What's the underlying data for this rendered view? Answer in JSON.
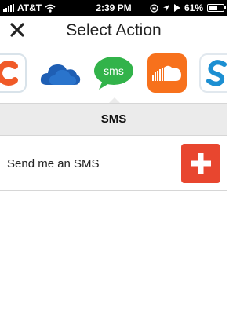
{
  "status_bar": {
    "carrier": "AT&T",
    "time": "2:39 PM",
    "battery_percent": "61%",
    "battery_level": 0.61
  },
  "nav": {
    "title": "Select Action",
    "close_icon": "close-icon"
  },
  "channels": [
    {
      "name": "c-app-icon",
      "color": "#f05a28"
    },
    {
      "name": "cloud-drive-icon",
      "color": "#1f5fb4"
    },
    {
      "name": "sms-icon",
      "label": "sms",
      "color": "#32b34a",
      "selected": true
    },
    {
      "name": "soundcloud-icon",
      "color": "#f7711c"
    },
    {
      "name": "s-app-icon",
      "color": "#1c8fd2"
    }
  ],
  "section": {
    "title": "SMS"
  },
  "actions": [
    {
      "label": "Send me an SMS",
      "button_icon": "plus-icon",
      "accent": "#e8462f"
    }
  ]
}
